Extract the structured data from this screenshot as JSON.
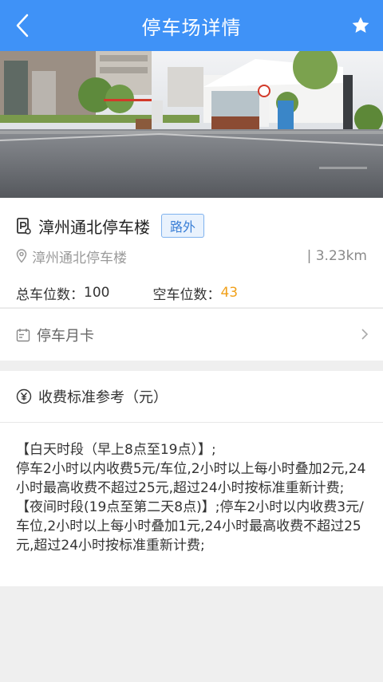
{
  "header": {
    "title": "停车场详情"
  },
  "lot": {
    "name": "漳州通北停车楼",
    "badge": "路外",
    "address": "漳州通北停车楼",
    "distance": "| 3.23km",
    "total_label": "总车位数：",
    "total_value": "100",
    "free_label": "空车位数：",
    "free_value": "43"
  },
  "monthly_card": {
    "label": "停车月卡"
  },
  "fee": {
    "heading": "收费标准参考（元）",
    "text": "【白天时段（早上8点至19点）】;\n停车2小时以内收费5元/车位,2小时以上每小时叠加2元,24小时最高收费不超过25元,超过24小时按标准重新计费;\n【夜间时段(19点至第二天8点)】;停车2小时以内收费3元/车位,2小时以上每小时叠加1元,24小时最高收费不超过25元,超过24小时按标准重新计费;"
  },
  "colors": {
    "header_bg": "#3f92f7",
    "free_value": "#f0a01a",
    "badge_text": "#3a7fd6"
  }
}
